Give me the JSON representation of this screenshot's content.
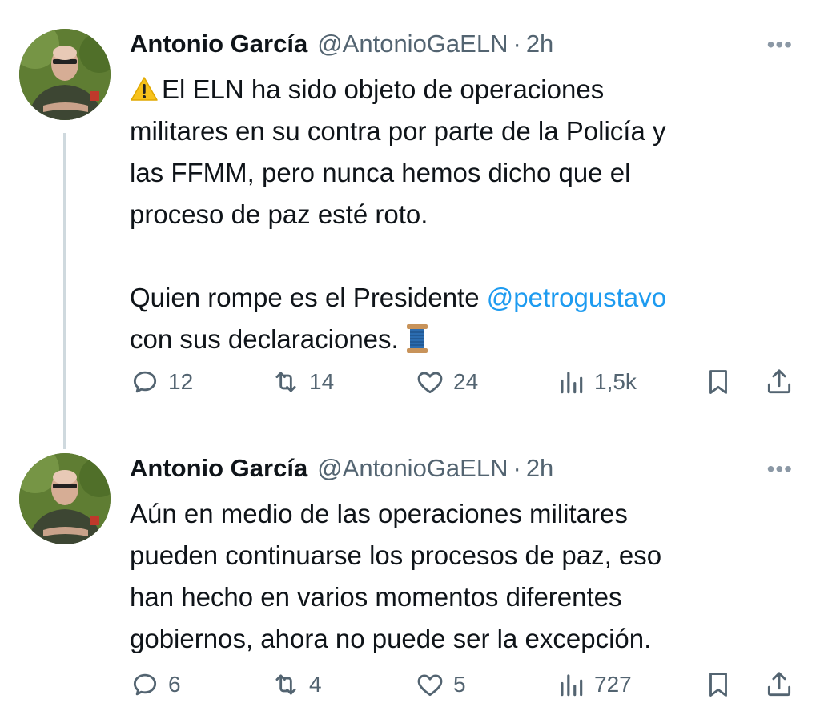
{
  "tweets": [
    {
      "name": "Antonio García",
      "handle": "@AntonioGaELN",
      "separator": "·",
      "time": "2h",
      "more": "•••",
      "text_line1": "El ELN ha sido objeto de operaciones",
      "text_rest": "militares en su contra por parte de la Policía y\nlas FFMM, pero nunca hemos dicho que el\nproceso de paz esté roto.\n\nQuien rompe es el Presidente ",
      "mention": "@petrogustavo",
      "text_tail": "\ncon sus declaraciones.",
      "replies": "12",
      "retweets": "14",
      "likes": "24",
      "views": "1,5k"
    },
    {
      "name": "Antonio García",
      "handle": "@AntonioGaELN",
      "separator": "·",
      "time": "2h",
      "more": "•••",
      "text": "Aún en medio de las operaciones militares\npueden continuarse los procesos de paz, eso\nhan hecho en varios momentos diferentes\ngobiernos, ahora no puede ser la excepción.",
      "replies": "6",
      "retweets": "4",
      "likes": "5",
      "views": "727"
    }
  ],
  "icons": {
    "reply": "reply-icon",
    "retweet": "retweet-icon",
    "like": "heart-icon",
    "views": "views-icon",
    "bookmark": "bookmark-icon",
    "share": "share-icon",
    "warning": "warning-emoji",
    "spool": "thread-spool-emoji"
  },
  "colors": {
    "text": "#0f1419",
    "secondary": "#536471",
    "link": "#1d9bf0",
    "thread_line": "#cfd9de"
  }
}
